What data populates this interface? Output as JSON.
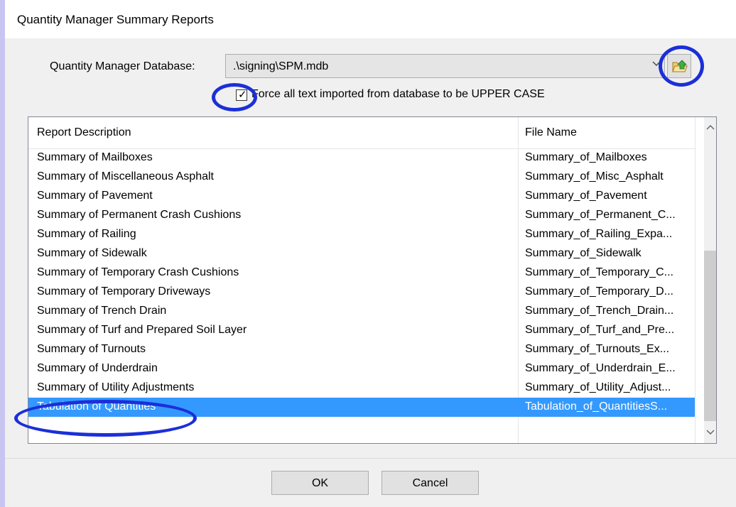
{
  "window": {
    "title": "Quantity Manager Summary Reports"
  },
  "database": {
    "label": "Quantity Manager Database:",
    "value": ".\\signing\\SPM.mdb"
  },
  "uppercase_option": {
    "checked": true,
    "label": "Force all text imported from database to be UPPER CASE"
  },
  "report_grid": {
    "columns": [
      "Report Description",
      "File Name"
    ],
    "rows": [
      {
        "description": "Summary of Mailboxes",
        "file": "Summary_of_Mailboxes"
      },
      {
        "description": "Summary of Miscellaneous Asphalt",
        "file": "Summary_of_Misc_Asphalt"
      },
      {
        "description": "Summary of Pavement",
        "file": "Summary_of_Pavement"
      },
      {
        "description": "Summary of Permanent Crash Cushions",
        "file": "Summary_of_Permanent_C..."
      },
      {
        "description": "Summary of Railing",
        "file": "Summary_of_Railing_Expa..."
      },
      {
        "description": "Summary of Sidewalk",
        "file": "Summary_of_Sidewalk"
      },
      {
        "description": "Summary of Temporary Crash Cushions",
        "file": "Summary_of_Temporary_C..."
      },
      {
        "description": "Summary of Temporary Driveways",
        "file": "Summary_of_Temporary_D..."
      },
      {
        "description": "Summary of Trench Drain",
        "file": "Summary_of_Trench_Drain..."
      },
      {
        "description": "Summary of Turf and Prepared Soil Layer",
        "file": "Summary_of_Turf_and_Pre..."
      },
      {
        "description": "Summary of Turnouts",
        "file": "Summary_of_Turnouts_Ex..."
      },
      {
        "description": "Summary of Underdrain",
        "file": "Summary_of_Underdrain_E..."
      },
      {
        "description": "Summary of Utility Adjustments",
        "file": "Summary_of_Utility_Adjust..."
      },
      {
        "description": "Tabulation of Quantities",
        "file": "Tabulation_of_QuantitiesS..."
      }
    ],
    "selected_index": 13
  },
  "icons": {
    "combo_arrow": "chevron-down-icon",
    "browse": "folder-open-icon",
    "scroll_up": "chevron-up-icon",
    "scroll_down": "chevron-down-icon"
  },
  "buttons": {
    "ok": "OK",
    "cancel": "Cancel"
  },
  "colors": {
    "selection": "#3399ff",
    "annotation": "#1b2fd8",
    "window_background": "#c8c6f0"
  }
}
